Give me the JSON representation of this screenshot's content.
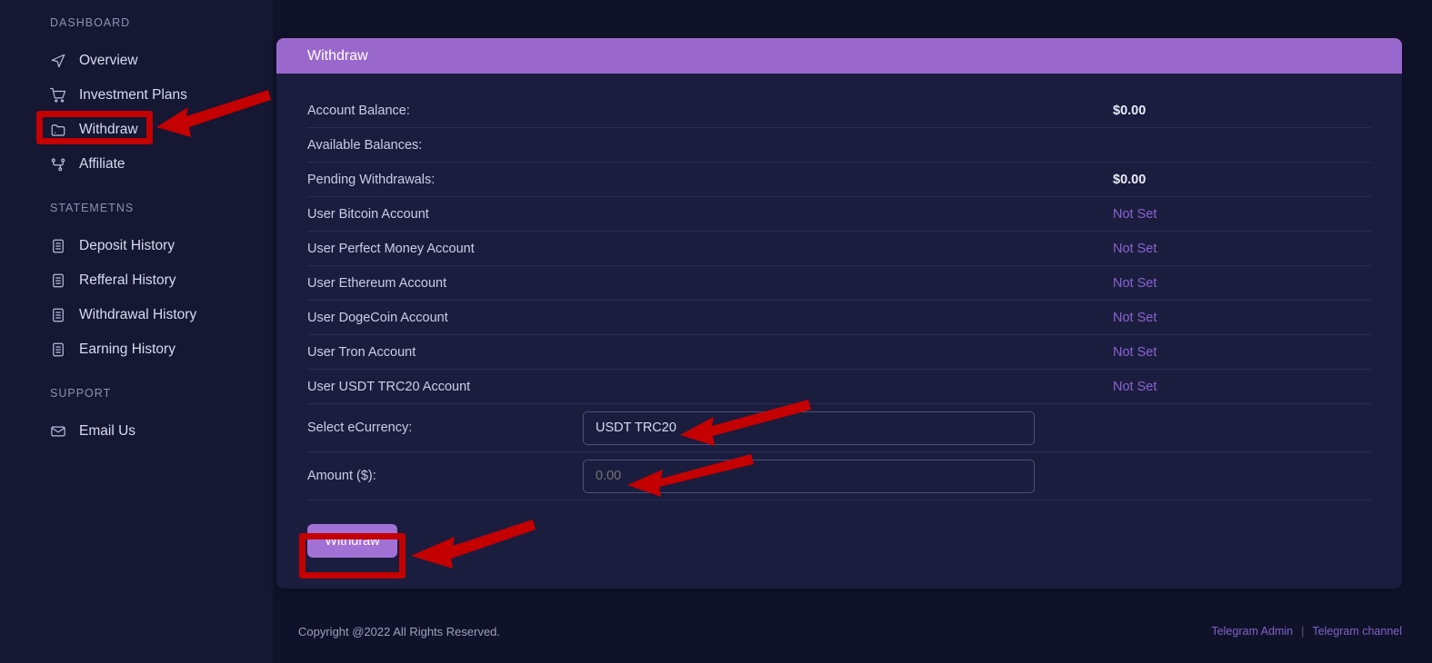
{
  "sidebar": {
    "sections": [
      {
        "title": "DASHBOARD",
        "items": [
          {
            "label": "Overview",
            "icon": "navigation-arrow-icon"
          },
          {
            "label": "Investment Plans",
            "icon": "shopping-cart-icon"
          },
          {
            "label": "Withdraw",
            "icon": "folder-icon"
          },
          {
            "label": "Affiliate",
            "icon": "share-network-icon"
          }
        ]
      },
      {
        "title": "STATEMETNS",
        "items": [
          {
            "label": "Deposit History",
            "icon": "document-list-icon"
          },
          {
            "label": "Refferal History",
            "icon": "document-list-icon"
          },
          {
            "label": "Withdrawal History",
            "icon": "document-list-icon"
          },
          {
            "label": "Earning History",
            "icon": "document-list-icon"
          }
        ]
      },
      {
        "title": "SUPPORT",
        "items": [
          {
            "label": "Email Us",
            "icon": "envelope-icon"
          }
        ]
      }
    ]
  },
  "panel": {
    "title": "Withdraw",
    "rows": [
      {
        "label": "Account Balance:",
        "value": "$0.00",
        "muted": false
      },
      {
        "label": "Available Balances:",
        "value": "",
        "muted": false
      },
      {
        "label": "Pending Withdrawals:",
        "value": "$0.00",
        "muted": false
      },
      {
        "label": "User Bitcoin Account",
        "value": "Not Set",
        "muted": true
      },
      {
        "label": "User Perfect Money Account",
        "value": "Not Set",
        "muted": true
      },
      {
        "label": "User Ethereum Account",
        "value": "Not Set",
        "muted": true
      },
      {
        "label": "User DogeCoin Account",
        "value": "Not Set",
        "muted": true
      },
      {
        "label": "User Tron Account",
        "value": "Not Set",
        "muted": true
      },
      {
        "label": "User USDT TRC20 Account",
        "value": "Not Set",
        "muted": true
      }
    ],
    "form": {
      "currency_label": "Select eCurrency:",
      "currency_value": "USDT TRC20",
      "amount_label": "Amount ($):",
      "amount_value": "",
      "amount_placeholder": "0.00",
      "submit_label": "Withdraw"
    }
  },
  "footer": {
    "copyright": "Copyright @2022 All Rights Reserved.",
    "link_admin": "Telegram Admin",
    "separator": "|",
    "link_channel": "Telegram channel"
  },
  "colors": {
    "accent_purple": "#9a68cd",
    "button_purple": "#a271d6",
    "link_purple": "#7f63c9",
    "page_background": "#10122a",
    "panel_background": "#1b1d3e",
    "sidebar_background": "#151733",
    "annotation_red": "#c40000"
  }
}
